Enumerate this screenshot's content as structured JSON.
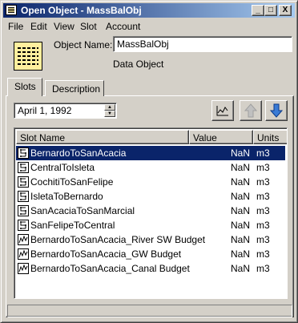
{
  "window": {
    "title": "Open Object - MassBalObj",
    "controls": {
      "minimize": "_",
      "maximize": "□",
      "close": "X"
    }
  },
  "menu": [
    "File",
    "Edit",
    "View",
    "Slot",
    "Account"
  ],
  "object": {
    "name_label": "Object Name:",
    "name_value": "MassBalObj",
    "type": "Data Object",
    "icon": "data-object-icon"
  },
  "tabs": [
    {
      "label": "Slots",
      "active": true
    },
    {
      "label": "Description",
      "active": false
    }
  ],
  "date": {
    "value": "April 1, 1992"
  },
  "toolbar": {
    "plot_icon": "plot-icon",
    "move_up_icon": "up-arrow-icon",
    "move_down_icon": "down-arrow-icon",
    "move_up_enabled": false
  },
  "table": {
    "columns": [
      "Slot Name",
      "Value",
      "Units"
    ],
    "rows": [
      {
        "name": "BernardoToSanAcacia",
        "value": "NaN",
        "units": "m3",
        "icon": "agg-series-slot-icon",
        "selected": true
      },
      {
        "name": "CentralToIsleta",
        "value": "NaN",
        "units": "m3",
        "icon": "agg-series-slot-icon",
        "selected": false
      },
      {
        "name": "CochitiToSanFelipe",
        "value": "NaN",
        "units": "m3",
        "icon": "agg-series-slot-icon",
        "selected": false
      },
      {
        "name": "IsletaToBernardo",
        "value": "NaN",
        "units": "m3",
        "icon": "agg-series-slot-icon",
        "selected": false
      },
      {
        "name": "SanAcaciaToSanMarcial",
        "value": "NaN",
        "units": "m3",
        "icon": "agg-series-slot-icon",
        "selected": false
      },
      {
        "name": "SanFelipeToCentral",
        "value": "NaN",
        "units": "m3",
        "icon": "agg-series-slot-icon",
        "selected": false
      },
      {
        "name": "BernardoToSanAcacia_River SW Budget",
        "value": "NaN",
        "units": "m3",
        "icon": "series-slot-icon",
        "selected": false
      },
      {
        "name": "BernardoToSanAcacia_GW Budget",
        "value": "NaN",
        "units": "m3",
        "icon": "series-slot-icon",
        "selected": false
      },
      {
        "name": "BernardoToSanAcacia_Canal Budget",
        "value": "NaN",
        "units": "m3",
        "icon": "series-slot-icon",
        "selected": false
      }
    ]
  }
}
